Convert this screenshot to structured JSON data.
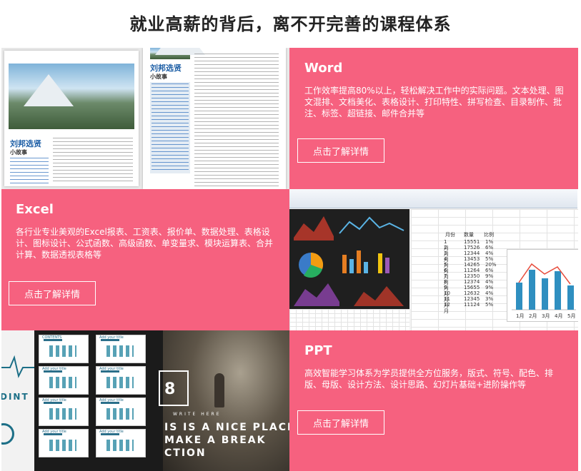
{
  "page": {
    "title": "就业高薪的背后，离不开完善的课程体系"
  },
  "accent_color": "#f6617f",
  "word": {
    "title": "Word",
    "description": "工作效率提高80%以上，轻松解决工作中的实际问题。文本处理、图文混排、文档美化、表格设计、打印特性、拼写检查、目录制作、批注、标签、超链接、邮件合并等",
    "button": "点击了解详情",
    "image": {
      "heading_left": "刘邦选贤",
      "sub_left": "小故事",
      "heading_right": "刘邦选贤",
      "sub_right": "小故事"
    }
  },
  "excel": {
    "title": "Excel",
    "description": "各行业专业美观的Excel报表、工资表、报价单、数据处理、表格设计、图标设计、公式函数、高级函数、单变量求、模块运算表、合并计算、数据透视表格等",
    "button": "点击了解详情",
    "image": {
      "col_headers": [
        "月份",
        "数量",
        "比例"
      ],
      "rows": [
        [
          "1月",
          "15551",
          "1%"
        ],
        [
          "2月",
          "17526",
          "6%"
        ],
        [
          "3月",
          "12344",
          "4%"
        ],
        [
          "4月",
          "13453",
          "5%"
        ],
        [
          "5月",
          "14265",
          "20%"
        ],
        [
          "6月",
          "11264",
          "6%"
        ],
        [
          "7月",
          "12350",
          "9%"
        ],
        [
          "8月",
          "12374",
          "4%"
        ],
        [
          "9月",
          "15655",
          "9%"
        ],
        [
          "10月",
          "12632",
          "4%"
        ],
        [
          "11月",
          "12345",
          "3%"
        ],
        [
          "12月",
          "11124",
          "5%"
        ]
      ],
      "chart_x_labels": [
        "1月",
        "2月",
        "3月",
        "4月",
        "5月"
      ]
    }
  },
  "ppt": {
    "title": "PPT",
    "description": "高效智能学习体系为学员提供全方位服务，版式、符号、配色、排版、母版、设计方法、设计思路、幻灯片基础+进阶操作等",
    "button": "点击了解详情",
    "image": {
      "number": "8",
      "small_caption": "WRITE HERE",
      "line1": "IS IS A NICE PLACE",
      "line2": "MAKE A BREAK",
      "line3": "CTION",
      "left_word": "DINT",
      "thumb_labels": [
        "CONTENTS",
        "Add your title",
        "Add your title",
        "Add your title",
        "Add your title",
        "Add your title",
        "Add your title",
        "Add your title"
      ]
    }
  }
}
